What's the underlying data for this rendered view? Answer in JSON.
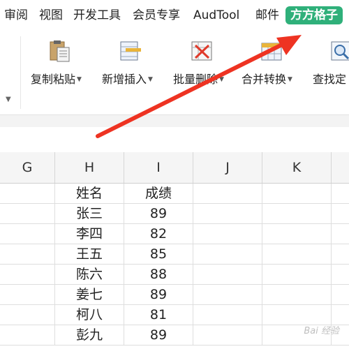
{
  "menu": {
    "tabs": [
      "审阅",
      "视图",
      "开发工具",
      "会员专享",
      "AudTool",
      "邮件",
      "方方格子"
    ],
    "active_tab": "方方格子",
    "active_color": "#2fb07a"
  },
  "ribbon": {
    "buttons": [
      {
        "label": "复制粘贴",
        "icon": "clipboard-paste-icon"
      },
      {
        "label": "新增插入",
        "icon": "insert-row-icon"
      },
      {
        "label": "批量删除",
        "icon": "delete-x-icon"
      },
      {
        "label": "合并转换",
        "icon": "merge-convert-icon"
      },
      {
        "label": "查找定",
        "icon": "find-icon"
      }
    ]
  },
  "sheet": {
    "columns": [
      "G",
      "H",
      "I",
      "J",
      "K"
    ],
    "header": {
      "name": "姓名",
      "score": "成绩"
    },
    "rows": [
      {
        "name": "张三",
        "score": "89"
      },
      {
        "name": "李四",
        "score": "82"
      },
      {
        "name": "王五",
        "score": "85"
      },
      {
        "name": "陈六",
        "score": "88"
      },
      {
        "name": "姜七",
        "score": "89"
      },
      {
        "name": "柯八",
        "score": "81"
      },
      {
        "name": "彭九",
        "score": "89"
      }
    ]
  },
  "annotation": {
    "arrow_color": "#ee3322"
  },
  "watermark": "Bai 经验"
}
